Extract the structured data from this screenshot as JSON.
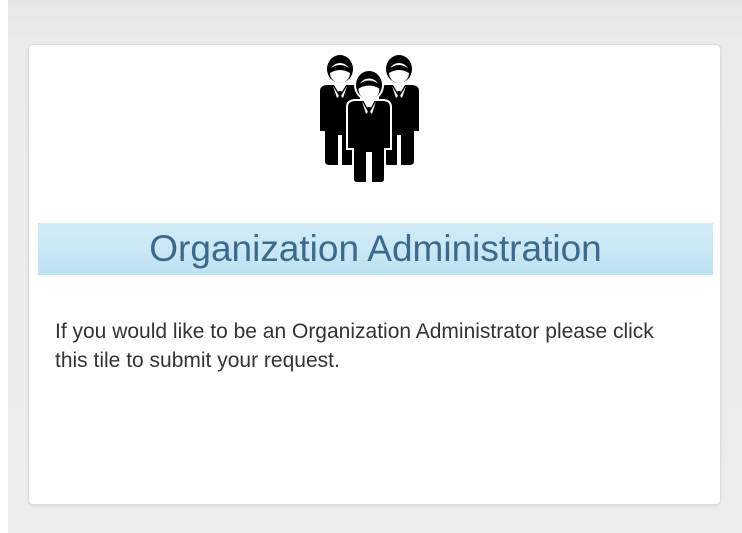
{
  "tile": {
    "icon": "people-group-icon",
    "title": "Organization Administration",
    "description": "If you would like to be an Organization Administrator please click this tile to submit your request."
  },
  "colors": {
    "title_band": "#c9e7f5",
    "title_text": "#3c6a8d",
    "description_text": "#333333",
    "icon": "#000000"
  }
}
